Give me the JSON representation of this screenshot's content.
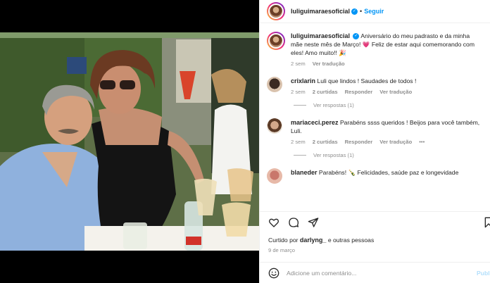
{
  "post": {
    "author": "luliguimaraesoficial",
    "follow_label": "Seguir",
    "caption": "Aniversário do meu padrasto e da minha mãe neste mês de Março! 💗 Feliz de estar aqui comemorando com eles! Amo muito!! 🎉",
    "caption_time": "2 sem",
    "see_translation": "Ver tradução"
  },
  "comments": [
    {
      "user": "crixlarin",
      "text": "Luli que lindos ! Saudades de todos !",
      "time": "2 sem",
      "likes": "2 curtidas",
      "reply": "Responder",
      "translate": "Ver tradução",
      "view_replies": "Ver respostas (1)"
    },
    {
      "user": "mariaceci.perez",
      "text": "Parabéns ssss queridos ! Beijos para você também, Luli.",
      "time": "2 sem",
      "likes": "2 curtidas",
      "reply": "Responder",
      "translate": "Ver tradução",
      "more": "•••",
      "view_replies": "Ver respostas (1)"
    },
    {
      "user": "blaneder",
      "text": "Parabéns! 🍾 Felicidades, saúde paz e longevidade"
    }
  ],
  "liked_by": {
    "prefix": "Curtido por",
    "user": "darlyng_",
    "suffix": "e outras pessoas"
  },
  "post_date": "9 de março",
  "comment_box": {
    "placeholder": "Adicione um comentário...",
    "publish": "Publi"
  },
  "icons": {
    "like": "heart-icon",
    "comment": "comment-icon",
    "share": "send-icon",
    "save": "bookmark-icon",
    "emoji": "emoji-icon",
    "verified": "verified-badge-icon"
  },
  "colors": {
    "link_blue": "#0095f6",
    "muted": "#8e8e8e",
    "text": "#262626"
  }
}
